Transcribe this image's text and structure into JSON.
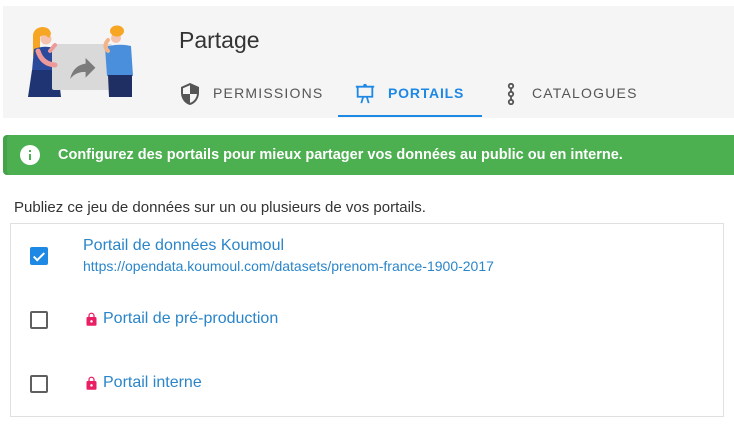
{
  "header": {
    "title": "Partage",
    "tabs": [
      {
        "label": "PERMISSIONS",
        "icon": "shield-icon",
        "active": false
      },
      {
        "label": "PORTAILS",
        "icon": "presentation-icon",
        "active": true
      },
      {
        "label": "CATALOGUES",
        "icon": "graph-dots-icon",
        "active": false
      }
    ]
  },
  "alert": {
    "icon": "info-icon",
    "text": "Configurez des portails pour mieux partager vos données au public ou en interne."
  },
  "intro": "Publiez ce jeu de données sur un ou plusieurs de vos portails.",
  "portals": [
    {
      "title": "Portail de données Koumoul",
      "url": "https://opendata.koumoul.com/datasets/prenom-france-1900-2017",
      "checked": true,
      "private": false
    },
    {
      "title": "Portail de pré-production",
      "checked": false,
      "private": true,
      "icon": "lock-icon"
    },
    {
      "title": "Portail interne",
      "checked": false,
      "private": true,
      "icon": "lock-icon"
    }
  ],
  "colors": {
    "primary": "#1e88e5",
    "success": "#4caf50",
    "private-lock": "#e91e63",
    "header-bg": "#f5f5f5",
    "link": "#2a85c9"
  }
}
